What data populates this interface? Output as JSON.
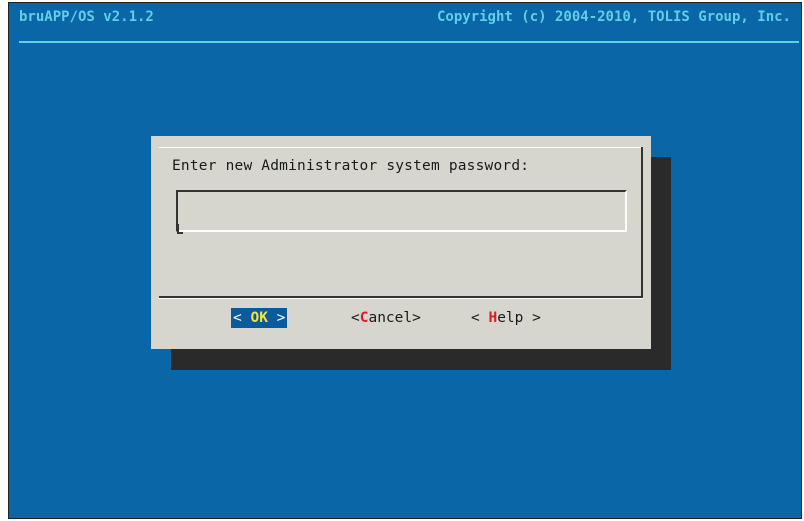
{
  "header": {
    "app_title": "bruAPP/OS v2.1.2",
    "copyright": "Copyright (c) 2004-2010, TOLIS Group, Inc."
  },
  "dialog": {
    "prompt": "Enter new Administrator system password:",
    "input_value": "",
    "buttons": {
      "ok": {
        "left": "< ",
        "hot": "OK",
        "right": " >"
      },
      "cancel": {
        "left": "<",
        "hot": "C",
        "right": "ancel>"
      },
      "help": {
        "left": "< ",
        "hot": "H",
        "right": "elp >"
      }
    }
  },
  "colors": {
    "background": "#0a66a6",
    "title_text": "#5fd0e8",
    "dialog": "#d6d6cf",
    "hotkey": "#d81e1e",
    "selected_button": "#0a5a9c",
    "selected_hotkey": "#f6e43c"
  }
}
